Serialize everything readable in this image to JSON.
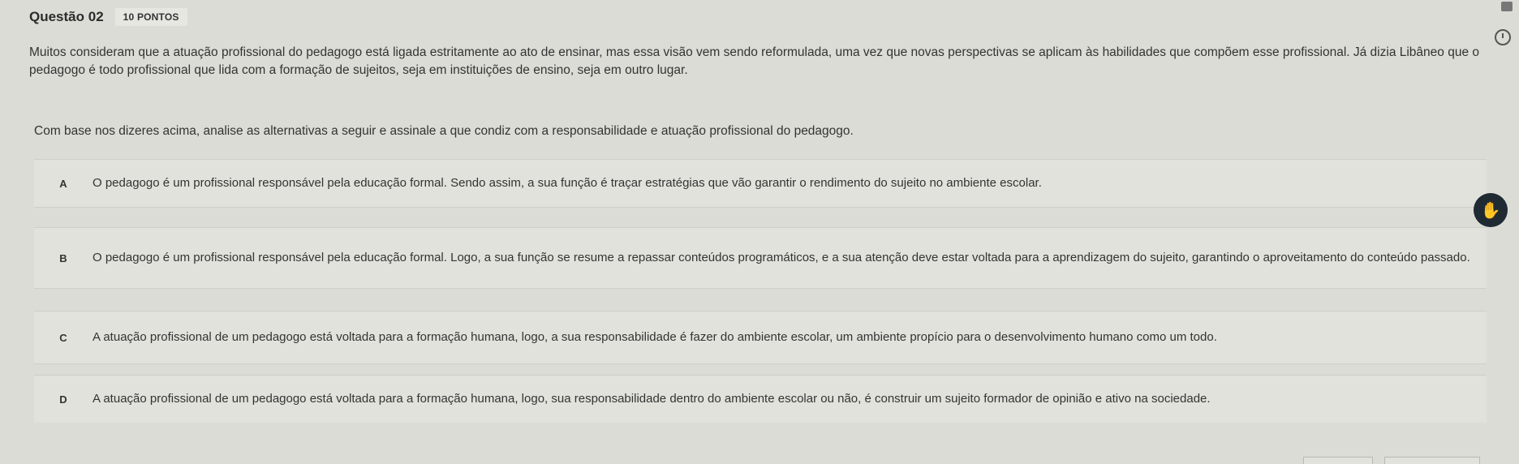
{
  "question": {
    "title": "Questão 02",
    "points": "10 PONTOS",
    "statement": "Muitos consideram que a atuação profissional do pedagogo está ligada estritamente ao ato de ensinar, mas essa visão vem sendo reformulada, uma vez que novas perspectivas se aplicam às habilidades que compõem esse profissional. Já dizia Libâneo que o pedagogo é todo profissional que lida com a formação de sujeitos, seja em instituições de ensino, seja em outro lugar.",
    "instruction": "Com base nos dizeres acima, analise as alternativas a seguir e assinale a que condiz com a responsabilidade e atuação profissional do pedagogo."
  },
  "alternatives": [
    {
      "letter": "A",
      "text": "O pedagogo é um profissional responsável pela educação formal. Sendo assim, a sua função é traçar estratégias que vão garantir o rendimento do sujeito no ambiente escolar."
    },
    {
      "letter": "B",
      "text": "O pedagogo é um profissional responsável pela educação formal. Logo, a sua função se resume a repassar conteúdos programáticos, e a sua atenção deve estar voltada para a aprendizagem do sujeito, garantindo o aproveitamento do conteúdo passado."
    },
    {
      "letter": "C",
      "text": "A atuação profissional de um pedagogo está voltada para a formação humana, logo, a sua responsabilidade é fazer do ambiente escolar, um ambiente propício para o desenvolvimento humano como um todo."
    },
    {
      "letter": "D",
      "text": "A atuação profissional de um pedagogo está voltada para a formação humana, logo, sua responsabilidade dentro do ambiente escolar ou não, é construir um sujeito formador de opinião e ativo na sociedade."
    }
  ],
  "icons": {
    "assist": "assist-icon",
    "clock": "clock-icon",
    "scroll_top": "scroll-top-icon"
  }
}
